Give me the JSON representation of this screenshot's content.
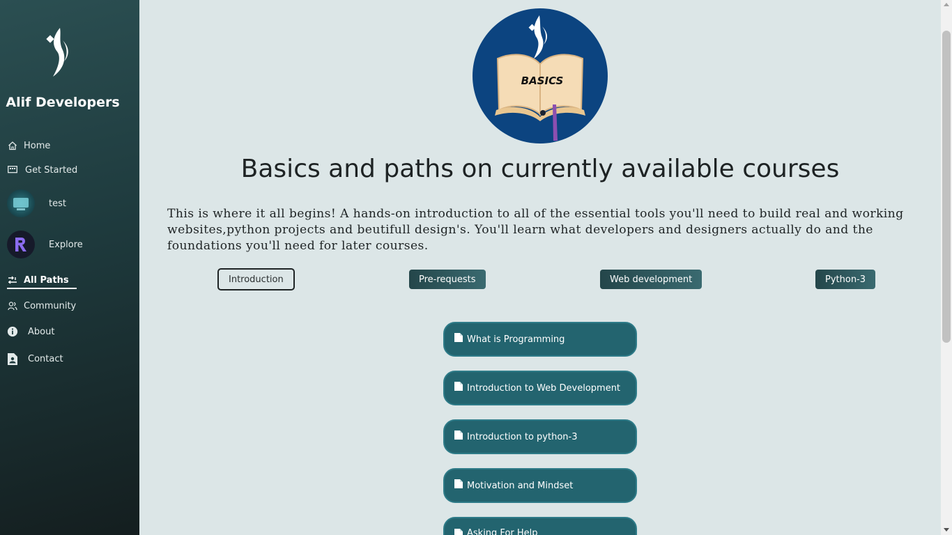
{
  "sidebar": {
    "brand": "Alif Developers",
    "items": [
      {
        "label": "Home",
        "icon": "home-icon"
      },
      {
        "label": "Get Started",
        "icon": "gallery-icon"
      },
      {
        "label": "test",
        "icon": "avatar"
      },
      {
        "label": "Explore",
        "icon": "avatar"
      },
      {
        "label": "All Paths",
        "icon": "paths-icon",
        "active": true
      },
      {
        "label": "Community",
        "icon": "community-icon"
      },
      {
        "label": "About",
        "icon": "info-icon"
      },
      {
        "label": "Contact",
        "icon": "contact-icon"
      }
    ]
  },
  "main": {
    "hero_badge_text": "BASICS",
    "title": "Basics and paths on currently available courses",
    "intro": "This is where it all begins! A hands-on introduction to all of the essential tools you'll need to build real and working websites,python projects and beutifull design's. You'll learn what developers and designers actually do and the foundations you'll need for later courses.",
    "tabs": [
      {
        "label": "Introduction",
        "active": true
      },
      {
        "label": "Pre-requests"
      },
      {
        "label": "Web development"
      },
      {
        "label": "Python-3"
      }
    ],
    "courses": [
      "What is Programming",
      "Introduction to Web Development",
      "Introduction to python-3",
      "Motivation and Mindset",
      "Asking For Help"
    ]
  },
  "colors": {
    "sidebar_top": "#2b4f52",
    "sidebar_bottom": "#141e1f",
    "background": "#dce6e7",
    "course_card": "#23646f",
    "hero_circle": "#0c4480"
  }
}
